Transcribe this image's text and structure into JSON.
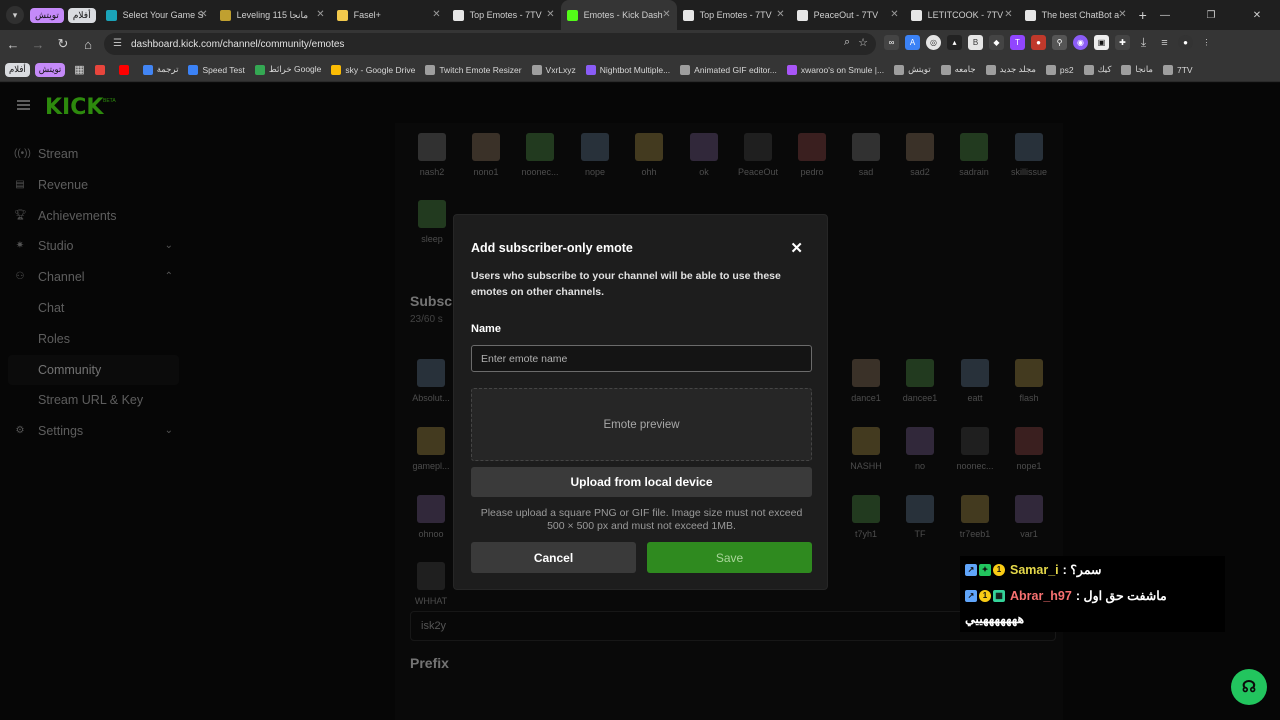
{
  "browser": {
    "group_chip_1": "تويتش",
    "group_chip_2": "أفلام",
    "tabs": [
      {
        "title": "Select Your Game S",
        "color": "#1aa3b8"
      },
      {
        "title": "Leveling 115 مانجا",
        "color": "#c0a030"
      },
      {
        "title": "Fasel+",
        "color": "#f2c94c"
      },
      {
        "title": "Top Emotes - 7TV",
        "color": "#e6e6e6"
      },
      {
        "title": "Emotes - Kick Dash",
        "color": "#53fc18"
      },
      {
        "title": "Top Emotes - 7TV",
        "color": "#e6e6e6"
      },
      {
        "title": "PeaceOut - 7TV",
        "color": "#e6e6e6"
      },
      {
        "title": "LETITCOOK - 7TV",
        "color": "#e6e6e6"
      },
      {
        "title": "The best ChatBot a",
        "color": "#e6e6e6"
      }
    ],
    "url": "dashboard.kick.com/channel/community/emotes",
    "bookmarks": [
      {
        "label": "",
        "color": "#e8453c"
      },
      {
        "label": "",
        "color": "#ff0000"
      },
      {
        "label": "ترجمة",
        "color": "#4285f4"
      },
      {
        "label": "Speed Test",
        "color": "#3b82f6"
      },
      {
        "label": "خرائط Google",
        "color": "#34a853"
      },
      {
        "label": "sky - Google Drive",
        "color": "#fbbc04"
      },
      {
        "label": "Twitch Emote Resizer",
        "color": "#9e9e9e"
      },
      {
        "label": "VxrLxyz",
        "color": "#9e9e9e"
      },
      {
        "label": "Nightbot Multiple...",
        "color": "#8a5cf6"
      },
      {
        "label": "Animated GIF editor...",
        "color": "#9e9e9e"
      },
      {
        "label": "xwaroo's on Smule |...",
        "color": "#a855f7"
      },
      {
        "label": "تويتش",
        "color": "#9e9e9e"
      },
      {
        "label": "جامعه",
        "color": "#9e9e9e"
      },
      {
        "label": "مجلد جديد",
        "color": "#9e9e9e"
      },
      {
        "label": "ps2",
        "color": "#9e9e9e"
      },
      {
        "label": "كيك",
        "color": "#9e9e9e"
      },
      {
        "label": "مانجا",
        "color": "#9e9e9e"
      },
      {
        "label": "7TV",
        "color": "#9e9e9e"
      }
    ],
    "bookmark_chip_1": "أفلام",
    "bookmark_chip_2": "تويتش"
  },
  "app": {
    "logo": "KICK",
    "logo_beta": "BETA",
    "nav": [
      {
        "label": "Stream",
        "icon": "stream-icon"
      },
      {
        "label": "Revenue",
        "icon": "revenue-icon"
      },
      {
        "label": "Achievements",
        "icon": "trophy-icon"
      },
      {
        "label": "Studio",
        "icon": "studio-icon"
      },
      {
        "label": "Channel",
        "icon": "channel-icon"
      }
    ],
    "channel_sub": [
      "Chat",
      "Roles",
      "Community",
      "Stream URL & Key"
    ],
    "settings_label": "Settings",
    "emotes_row1": [
      "nash2",
      "nono1",
      "noonec...",
      "nope",
      "ohh",
      "ok",
      "PeaceOut",
      "pedro",
      "sad",
      "sad2",
      "sadrain",
      "skillissue"
    ],
    "emotes_row2": [
      "sleep"
    ],
    "sub_section_title": "Subsc",
    "sub_section_count": "23/60 s",
    "left_col_emotes": [
      "Absolut...",
      "gamepl...",
      "ohnoo",
      "WHHAT"
    ],
    "right_emotes_row1": [
      "dance1",
      "dancee1",
      "eatt",
      "flash"
    ],
    "right_emotes_row2": [
      "NASHH",
      "no",
      "noonec...",
      "nope1"
    ],
    "right_emotes_row3": [
      "t7yh1",
      "TF",
      "tr7eeb1",
      "var1"
    ],
    "prefix_title": "Prefix",
    "prefix_value": "isk2y"
  },
  "modal": {
    "title": "Add subscriber-only emote",
    "description": "Users who subscribe to your channel will be able to use these emotes on other channels.",
    "name_label": "Name",
    "name_placeholder": "Enter emote name",
    "name_value": "",
    "preview_label": "Emote preview",
    "upload_label": "Upload from local device",
    "upload_hint": "Please upload a square PNG or GIF file. Image size must not exceed 500 × 500 px and must not exceed 1MB.",
    "cancel_label": "Cancel",
    "save_label": "Save"
  },
  "chat_overlay": {
    "line1_user": "Samar_i",
    "line1_msg": ": سمر؟",
    "line2_user": "Abrar_h97",
    "line2_msg": ": ماشفت حق اول",
    "line3_msg": "هههههههييي"
  }
}
